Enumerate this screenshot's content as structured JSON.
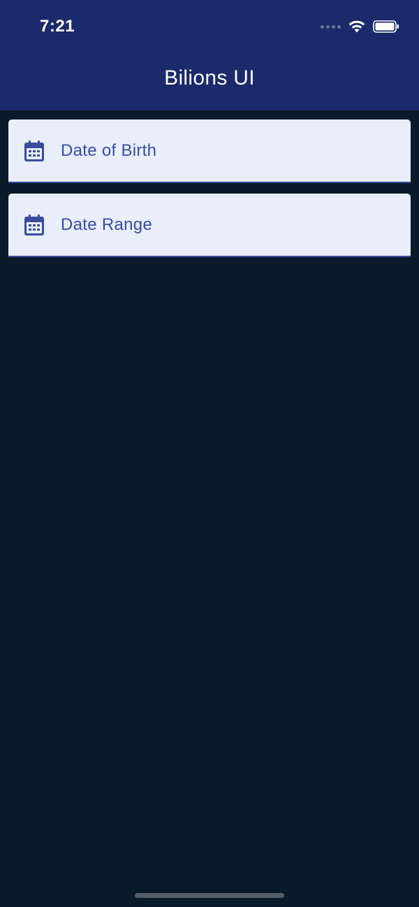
{
  "status_bar": {
    "time": "7:21",
    "icons": [
      "signal-dots-icon",
      "wifi-icon",
      "battery-icon"
    ]
  },
  "app_bar": {
    "title": "Bilions UI",
    "background": "#1a2a6a"
  },
  "fields": [
    {
      "label": "Date of Birth",
      "icon": "calendar-icon"
    },
    {
      "label": "Date Range",
      "icon": "calendar-icon"
    }
  ],
  "colors": {
    "background": "#0a1a28",
    "field_fill": "#e8eefa",
    "accent": "#3b4c9c",
    "text_on_bar": "#ffffff"
  }
}
